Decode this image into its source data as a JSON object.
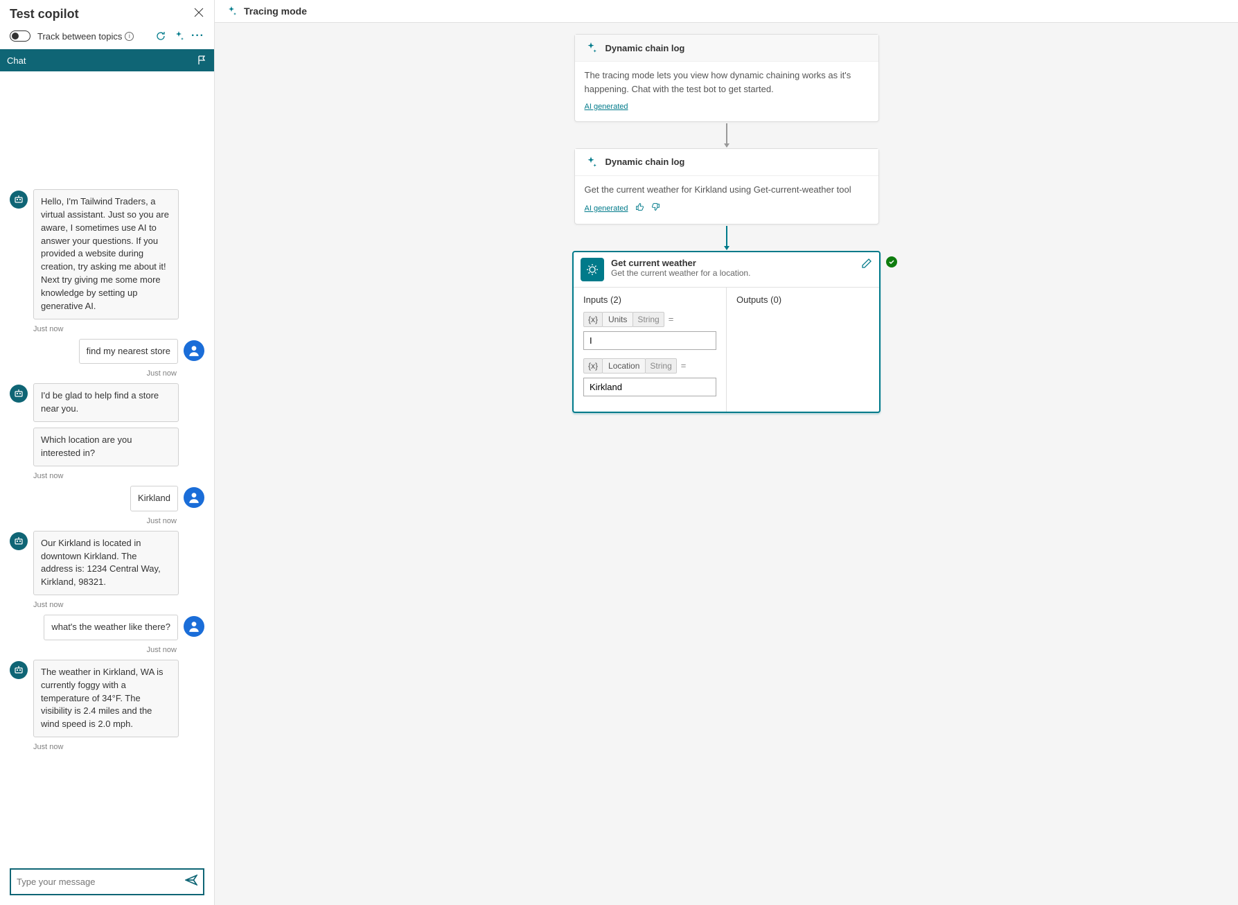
{
  "test_panel": {
    "title": "Test copilot",
    "toggle_label": "Track between topics"
  },
  "chat": {
    "header_title": "Chat",
    "messages": [
      {
        "role": "bot",
        "text": "Hello, I'm Tailwind Traders, a virtual assistant. Just so you are aware, I sometimes use AI to answer your questions. If you provided a website during creation, try asking me about it! Next try giving me some more knowledge by setting up generative AI.",
        "ts": "Just now"
      },
      {
        "role": "user",
        "text": "find my nearest store",
        "ts": "Just now"
      },
      {
        "role": "bot",
        "text": "I'd be glad to help find a store near you.",
        "text2": "Which location are you interested in?",
        "ts": "Just now"
      },
      {
        "role": "user",
        "text": "Kirkland",
        "ts": "Just now"
      },
      {
        "role": "bot",
        "text": "Our Kirkland is located in downtown Kirkland. The address is: 1234 Central Way, Kirkland, 98321.",
        "ts": "Just now"
      },
      {
        "role": "user",
        "text": "what's the weather like there?",
        "ts": "Just now"
      },
      {
        "role": "bot",
        "text": "The weather in Kirkland, WA is currently foggy with a temperature of 34°F. The visibility is 2.4 miles and the wind speed is 2.0 mph.",
        "ts": "Just now"
      }
    ],
    "input_placeholder": "Type your message"
  },
  "canvas": {
    "title": "Tracing mode",
    "cards": [
      {
        "title": "Dynamic chain log",
        "body": "The tracing mode lets you view how dynamic chaining works as it's happening. Chat with the test bot to get started.",
        "ai_generated": "AI generated",
        "thumbs": false
      },
      {
        "title": "Dynamic chain log",
        "body": "Get the current weather for Kirkland using Get-current-weather tool",
        "ai_generated": "AI generated",
        "thumbs": true
      }
    ],
    "action": {
      "title": "Get current weather",
      "subtitle": "Get the current weather for a location.",
      "inputs_label": "Inputs (2)",
      "outputs_label": "Outputs (0)",
      "params": [
        {
          "name": "Units",
          "type": "String",
          "value": "I"
        },
        {
          "name": "Location",
          "type": "String",
          "value": "Kirkland"
        }
      ],
      "var_chip": "{x}"
    }
  }
}
